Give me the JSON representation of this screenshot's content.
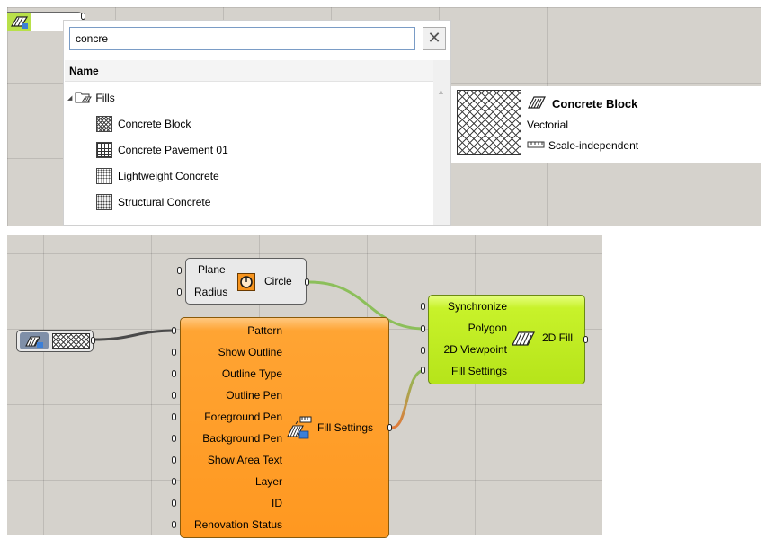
{
  "search": {
    "value": "concre",
    "clear_symbol": "✕"
  },
  "list": {
    "column_header": "Name",
    "root": {
      "label": "Fills",
      "expand_glyph": "◢"
    },
    "items": [
      {
        "label": "Concrete Block",
        "pattern": "crosshatch"
      },
      {
        "label": "Concrete Pavement 01",
        "pattern": "brick"
      },
      {
        "label": "Lightweight Concrete",
        "pattern": "dots"
      },
      {
        "label": "Structural Concrete",
        "pattern": "dense-dots"
      }
    ]
  },
  "preview": {
    "name": "Concrete Block",
    "type": "Vectorial",
    "scale": "Scale-independent"
  },
  "circle_component": {
    "inputs": [
      "Plane",
      "Radius"
    ],
    "output": "Circle",
    "icon": "circle-icon"
  },
  "fill_settings_component": {
    "inputs": [
      "Pattern",
      "Show Outline",
      "Outline Type",
      "Outline Pen",
      "Foreground Pen",
      "Background Pen",
      "Show Area Text",
      "Layer",
      "ID",
      "Renovation Status"
    ],
    "output": "Fill Settings",
    "icon": "fill-settings-icon",
    "color": "#ff9d2a"
  },
  "fill_2d_component": {
    "inputs": [
      "Synchronize",
      "Polygon",
      "2D Viewpoint",
      "Fill Settings"
    ],
    "output": "2D Fill",
    "icon": "fill-icon",
    "color": "#c3ef27"
  },
  "pattern_param": {
    "icon": "fill-param-icon",
    "swatch": "crosshatch"
  },
  "wire_colors": {
    "dark": "#4a4a4a",
    "green": "#8cbf5a",
    "orange": "#e07a3a"
  }
}
